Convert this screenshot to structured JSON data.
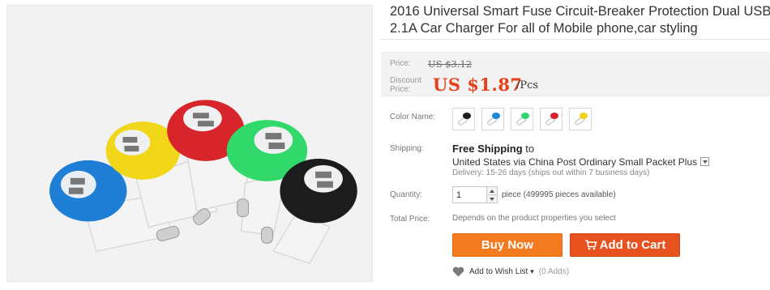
{
  "product": {
    "title_line1": "2016 Universal Smart Fuse Circuit-Breaker Protection Dual USB",
    "title_line2": "2.1A Car Charger For all of Mobile phone,car styling"
  },
  "price": {
    "label": "Price:",
    "original": "US $3.12",
    "discount_label_1": "Discount",
    "discount_label_2": "Price:",
    "discount_value": "US $1.87",
    "unit": "/Pcs",
    "discount_color": "#e5411a"
  },
  "color": {
    "label": "Color Name:",
    "options": [
      {
        "name": "black",
        "hex": "#1b1b1b"
      },
      {
        "name": "blue",
        "hex": "#1e88d8"
      },
      {
        "name": "green",
        "hex": "#2fd66a"
      },
      {
        "name": "red",
        "hex": "#d8232a"
      },
      {
        "name": "yellow",
        "hex": "#f1d21a"
      }
    ]
  },
  "shipping": {
    "label": "Shipping:",
    "free": "Free Shipping",
    "to": "to",
    "method": "United States via China Post Ordinary Small Packet Plus",
    "delivery": "Delivery: 15-26 days (ships out within 7 business days)"
  },
  "quantity": {
    "label": "Quantity:",
    "value": "1",
    "note": "piece (499995 pieces available)"
  },
  "total": {
    "label": "Total Price:",
    "value": "Depends on the product properties you select"
  },
  "actions": {
    "buy_now": "Buy Now",
    "add_to_cart": "Add to Cart",
    "buy_color": "#f37a1f",
    "cart_color": "#e8521e"
  },
  "wishlist": {
    "label": "Add to Wish List",
    "count": "(0 Adds)"
  }
}
